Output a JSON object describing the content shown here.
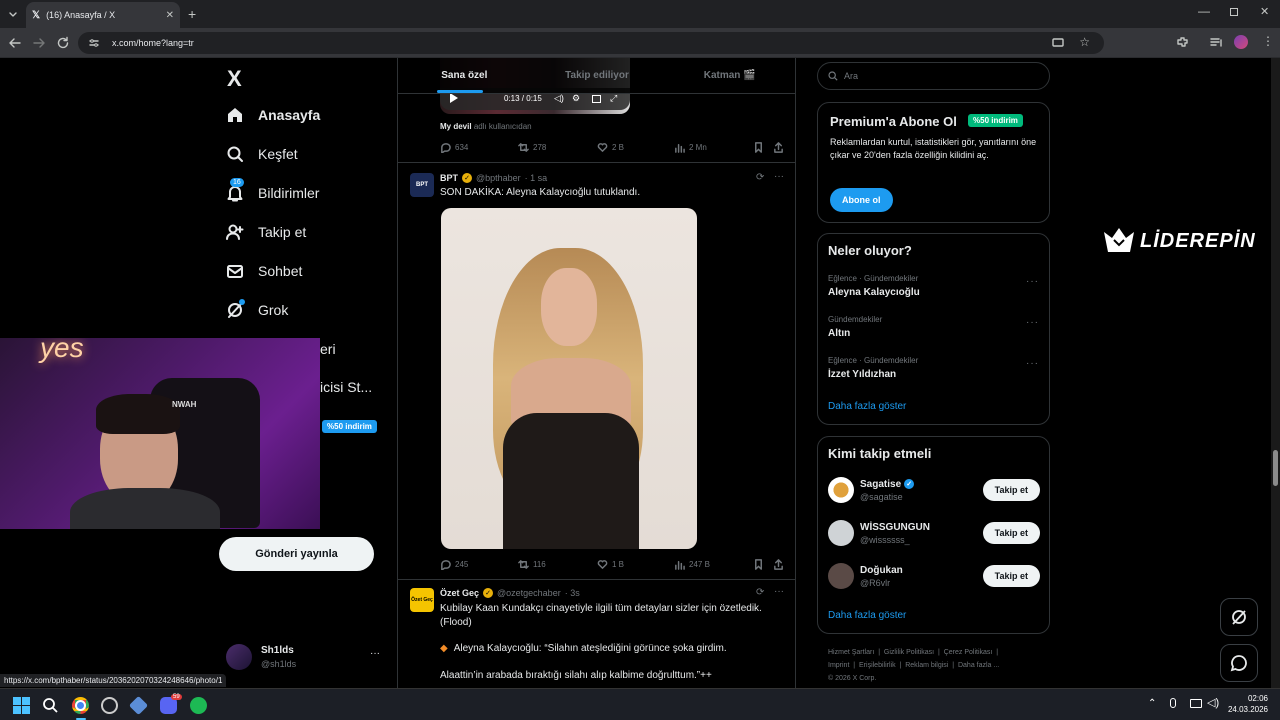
{
  "browser": {
    "tab_title": "(16) Anasayfa / X",
    "url": "x.com/home?lang=tr",
    "status_url": "https://x.com/bpthaber/status/2036202070324248646/photo/1"
  },
  "nav": {
    "logo": "X",
    "items": [
      {
        "label": "Anasayfa",
        "icon": "home-icon"
      },
      {
        "label": "Keşfet",
        "icon": "search-icon"
      },
      {
        "label": "Bildirimler",
        "icon": "bell-icon",
        "badge": "16"
      },
      {
        "label": "Takip et",
        "icon": "follow-icon"
      },
      {
        "label": "Sohbet",
        "icon": "mail-icon"
      },
      {
        "label": "Grok",
        "icon": "grok-icon"
      },
      {
        "label": "eri"
      },
      {
        "label": "icisi St..."
      }
    ],
    "premium_badge": "%50 indirim",
    "post_button": "Gönderi yayınla",
    "profile": {
      "name": "Sh1lds",
      "handle": "@sh1lds"
    }
  },
  "feed": {
    "tabs": [
      "Sana özel",
      "Takip ediliyor",
      "Katman 🎬"
    ],
    "video": {
      "time": "0:13 / 0:15",
      "caption_user": "My devil",
      "caption_rest": "adlı kullanıcıdan"
    },
    "post0_actions": {
      "replies": "634",
      "reposts": "278",
      "likes": "2 B",
      "views": "2 Mn"
    },
    "post1": {
      "name": "BPT",
      "handle": "@bpthaber",
      "time": "· 1 sa",
      "avatar": "BPT",
      "text": "SON DAKİKA: Aleyna Kalaycıoğlu tutuklandı.",
      "replies": "245",
      "reposts": "116",
      "likes": "1 B",
      "views": "247 B"
    },
    "post2": {
      "name": "Özet Geç",
      "handle": "@ozetgechaber",
      "time": "· 3s",
      "avatar": "Özet Geç",
      "text": "Kubilay Kaan Kundakçı cinayetiyle ilgili tüm detayları sizler için özetledik. (Flood)",
      "quote": "Aleyna Kalaycıoğlu: “Silahın ateşlediğini görünce şoka girdim.",
      "line2": "Alaattin’in arabada bıraktığı silahı alıp kalbime doğrulttum.”++"
    }
  },
  "right": {
    "search_placeholder": "Ara",
    "premium": {
      "title": "Premium'a Abone Ol",
      "badge": "%50 indirim",
      "desc": "Reklamlardan kurtul, istatistikleri gör, yanıtlarını öne çıkar ve 20'den fazla özelliğin kilidini aç.",
      "button": "Abone ol"
    },
    "trends": {
      "title": "Neler oluyor?",
      "items": [
        {
          "context": "Eğlence · Gündemdekiler",
          "name": "Aleyna Kalaycıoğlu"
        },
        {
          "context": "Gündemdekiler",
          "name": "Altın"
        },
        {
          "context": "Eğlence · Gündemdekiler",
          "name": "İzzet Yıldızhan"
        }
      ],
      "more": "Daha fazla göster"
    },
    "who": {
      "title": "Kimi takip etmeli",
      "items": [
        {
          "name": "Sagatise",
          "handle": "@sagatise",
          "verified": true
        },
        {
          "name": "WİSSGUNGUN",
          "handle": "@wissssss_"
        },
        {
          "name": "Doğukan",
          "handle": "@R6vlr"
        }
      ],
      "button": "Takip et",
      "more": "Daha fazla göster"
    },
    "footer": [
      "Hizmet Şartları",
      "|",
      "Gizlilik Politikası",
      "|",
      "Çerez Politikası",
      "|",
      "Imprint",
      "|",
      "Erişilebilirlik",
      "|",
      "Reklam bilgisi",
      "|",
      "Daha fazla ...",
      "© 2026 X Corp."
    ]
  },
  "overlay": {
    "brand": "LİDEREPİN",
    "sign_text": "yes",
    "cap_text": "NWAH"
  },
  "taskbar": {
    "time": "02:06",
    "date": "24.03.2026",
    "discord_badge": "59"
  },
  "colors": {
    "accent": "#1d9bf0",
    "verified": "#1d9bf0",
    "gold": "#e8b00b",
    "premium_badge_bg": "#00ba7c"
  }
}
